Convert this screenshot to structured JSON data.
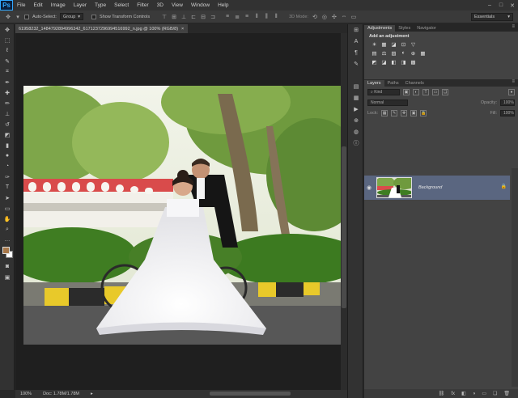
{
  "app": {
    "logo": "Ps"
  },
  "menu": [
    "File",
    "Edit",
    "Image",
    "Layer",
    "Type",
    "Select",
    "Filter",
    "3D",
    "View",
    "Window",
    "Help"
  ],
  "window_controls": [
    "–",
    "□",
    "✕"
  ],
  "options": {
    "auto_select": "Auto-Select:",
    "group": "Group",
    "show_transform": "Show Transform Controls",
    "mode_3d": "3D Mode:",
    "workspace": "Essentials"
  },
  "document": {
    "tab_title": "61958232_1484792894996342_6171237296994516992_n.jpg @ 100% (RGB/8)",
    "close": "×"
  },
  "status": {
    "zoom": "100%",
    "doc": "Doc: 1.78M/1.78M",
    "arrow": "▸"
  },
  "adjustments": {
    "tabs": [
      "Adjustments",
      "Styles",
      "Navigator"
    ],
    "title": "Add an adjustment",
    "row1": [
      "☀",
      "▦",
      "◪",
      "⊡",
      "▽"
    ],
    "row2": [
      "▤",
      "⚖",
      "▨",
      "◐",
      "⊕",
      "▦"
    ],
    "row3": [
      "◩",
      "◪",
      "◧",
      "◨",
      "▩"
    ]
  },
  "layers": {
    "tabs": [
      "Layers",
      "Paths",
      "Channels"
    ],
    "kind": "Kind",
    "blend": "Normal",
    "opacity_label": "Opacity:",
    "opacity": "100%",
    "lock_label": "Lock:",
    "fill_label": "Fill:",
    "fill": "100%",
    "items": [
      {
        "name": "Background"
      }
    ],
    "footer": [
      "⛓",
      "fx",
      "◧",
      "◑",
      "▭",
      "❏",
      "🗑"
    ]
  },
  "colors": {
    "foreground": "#a8784a",
    "background": "#ffffff",
    "selection": "#5a6680"
  }
}
